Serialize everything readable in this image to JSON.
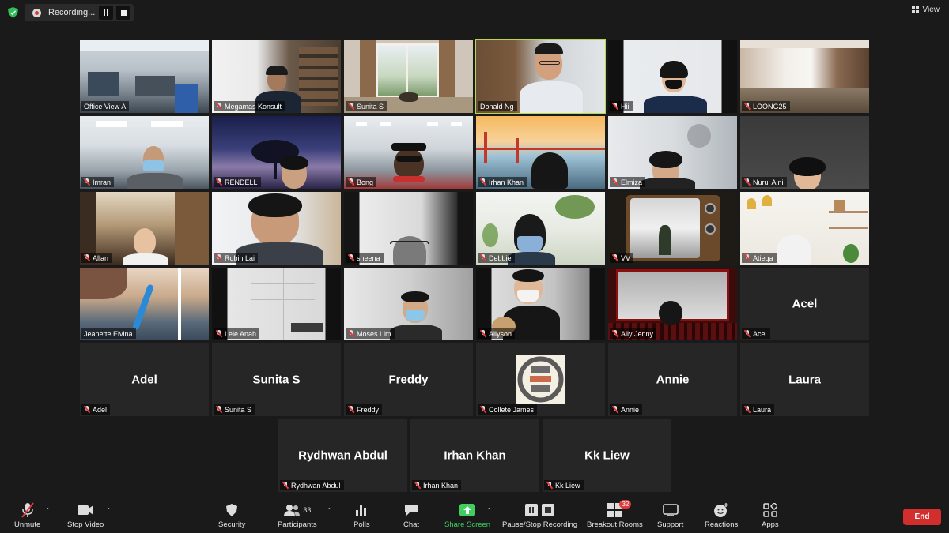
{
  "recording": {
    "label": "Recording..."
  },
  "view": {
    "label": "View"
  },
  "tiles": [
    {
      "name": "Office View A",
      "video": true
    },
    {
      "name": "Megamas Konsult",
      "video": true
    },
    {
      "name": "Sunita S",
      "video": true
    },
    {
      "name": "Donald Ng",
      "video": true,
      "active_speaker": true
    },
    {
      "name": "Hii",
      "video": true
    },
    {
      "name": "LOONG25",
      "video": true
    },
    {
      "name": "Imran",
      "video": true
    },
    {
      "name": "RENDELL",
      "video": true
    },
    {
      "name": "Bong",
      "video": true
    },
    {
      "name": "Irhan Khan",
      "video": true
    },
    {
      "name": "Elmiza",
      "video": true
    },
    {
      "name": "Nurul Aini",
      "video": true
    },
    {
      "name": "Allan",
      "video": true
    },
    {
      "name": "Robin Lai",
      "video": true
    },
    {
      "name": "sheena",
      "video": true
    },
    {
      "name": "Debbie",
      "video": true
    },
    {
      "name": "VV",
      "video": true
    },
    {
      "name": "Atieqa",
      "video": true
    },
    {
      "name": "Jeanette Elvina",
      "video": true
    },
    {
      "name": "Lele Anah",
      "video": true
    },
    {
      "name": "Moses Lim",
      "video": true
    },
    {
      "name": "Allyson",
      "video": true
    },
    {
      "name": "Ally Jenny",
      "video": true
    },
    {
      "name": "Acel",
      "display": "Acel",
      "video": false
    },
    {
      "name": "Adel",
      "display": "Adel",
      "video": false
    },
    {
      "name": "Sunita S",
      "display": "Sunita S",
      "video": false
    },
    {
      "name": "Freddy",
      "display": "Freddy",
      "video": false
    },
    {
      "name": "Collete James",
      "video": true
    },
    {
      "name": "Annie",
      "display": "Annie",
      "video": false
    },
    {
      "name": "Laura",
      "display": "Laura",
      "video": false
    },
    {
      "name": "Rydhwan Abdul",
      "display": "Rydhwan Abdul",
      "video": false
    },
    {
      "name": "Irhan Khan",
      "display": "Irhan Khan",
      "video": false
    },
    {
      "name": "Kk Liew",
      "display": "Kk Liew",
      "video": false
    }
  ],
  "toolbar": {
    "unmute": "Unmute",
    "stop_video": "Stop Video",
    "security": "Security",
    "participants": "Participants",
    "participants_count": "33",
    "polls": "Polls",
    "chat": "Chat",
    "share_screen": "Share Screen",
    "recording": "Pause/Stop Recording",
    "breakout": "Breakout Rooms",
    "breakout_count": "32",
    "support": "Support",
    "reactions": "Reactions",
    "apps": "Apps",
    "end": "End"
  },
  "colors": {
    "active_speaker_border": "#b5d94a",
    "end_button": "#d32e2e",
    "share_green": "#3fcf5e",
    "muted_red": "#e03b3b"
  }
}
